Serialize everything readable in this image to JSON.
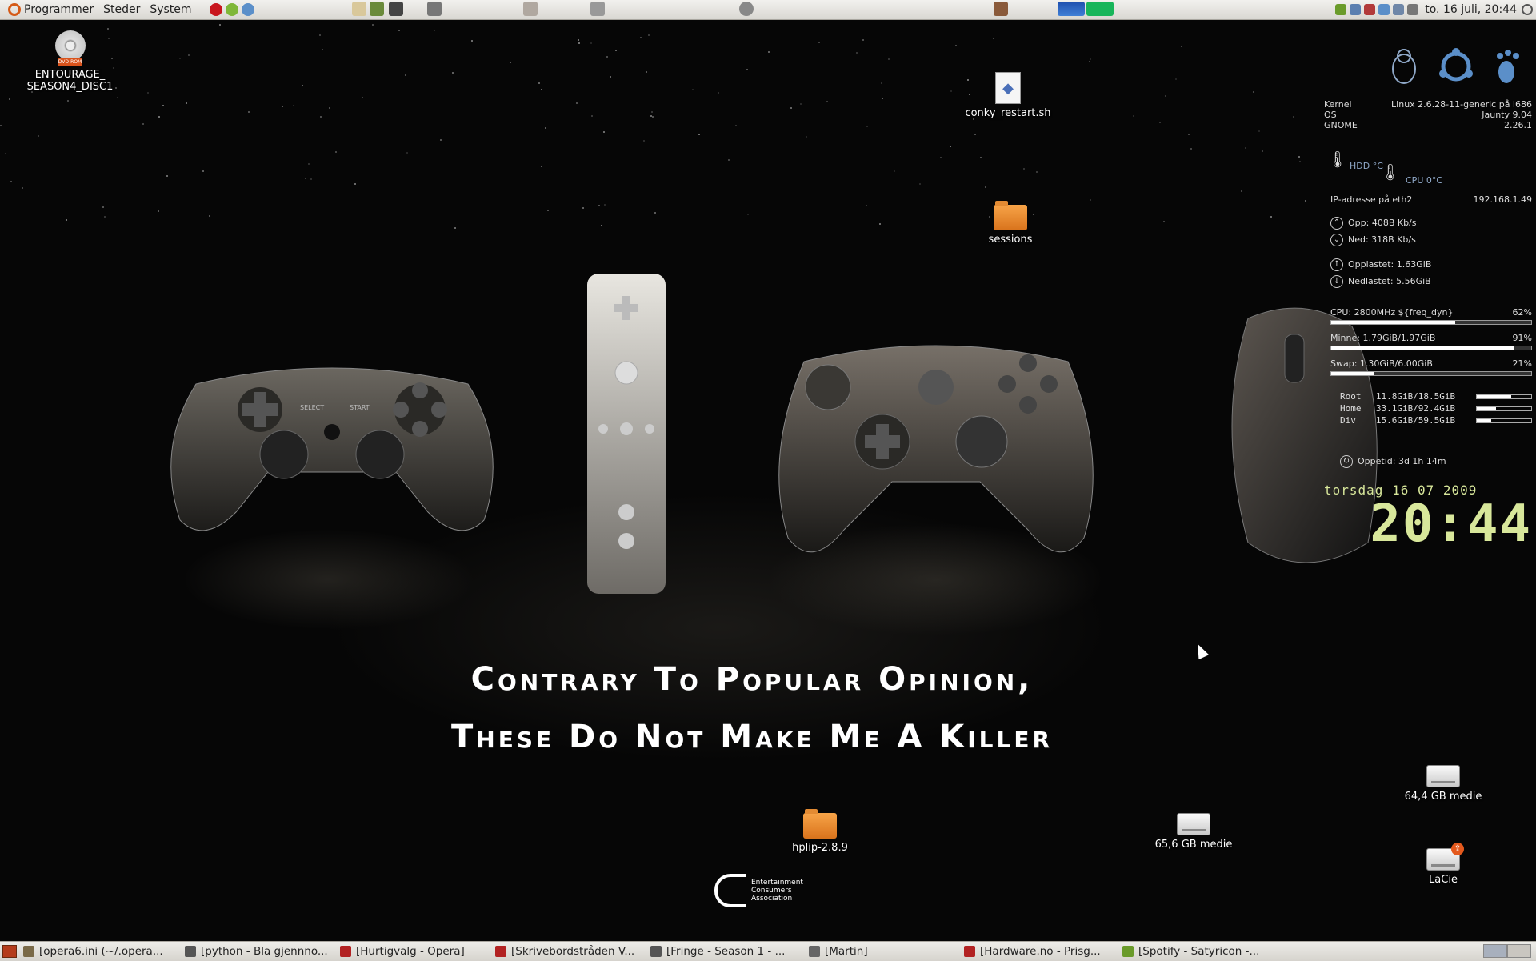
{
  "top_panel": {
    "menus": [
      "Programmer",
      "Steder",
      "System"
    ],
    "clock": "to. 16 juli, 20:44"
  },
  "desktop_icons": {
    "dvd": {
      "label": "ENTOURAGE_\nSEASON4_DISC1",
      "badge": "DVD-ROM"
    },
    "conky_restart": {
      "label": "conky_restart.sh"
    },
    "sessions": {
      "label": "sessions"
    },
    "hplip": {
      "label": "hplip-2.8.9"
    },
    "medie65": {
      "label": "65,6 GB medie"
    },
    "medie64": {
      "label": "64,4 GB medie"
    },
    "lacie": {
      "label": "LaCie"
    }
  },
  "wallpaper": {
    "caption_line1": "Contrary To Popular Opinion,",
    "caption_line2": "These Do Not Make Me A Killer",
    "eca_text": [
      "Entertainment",
      "Consumers",
      "Association"
    ],
    "ps3_labels": {
      "select": "SELECT",
      "start": "START"
    }
  },
  "conky": {
    "system": [
      {
        "label": "Kernel",
        "value": "Linux 2.6.28-11-generic på i686"
      },
      {
        "label": "OS",
        "value": "Jaunty 9.04"
      },
      {
        "label": "GNOME",
        "value": "2.26.1"
      }
    ],
    "hdd_temp": "HDD °C",
    "cpu_temp": "CPU 0°C",
    "ip_label": "IP-adresse på eth2",
    "ip_value": "192.168.1.49",
    "up": "Opp: 408B  Kb/s",
    "down": "Ned: 318B  Kb/s",
    "uploaded": "Opplastet: 1.63GiB",
    "downloaded": "Nedlastet: 5.56GiB",
    "cpu": {
      "label": "CPU:",
      "detail": "2800MHz ${freq_dyn}",
      "pct": "62%",
      "level": 0.62
    },
    "mem": {
      "label": "Minne:",
      "detail": "1.79GiB/1.97GiB",
      "pct": "91%",
      "level": 0.91
    },
    "swap": {
      "label": "Swap:",
      "detail": "1.30GiB/6.00GiB",
      "pct": "21%",
      "level": 0.21
    },
    "disks": [
      {
        "name": "Root",
        "value": "11.8GiB/18.5GiB",
        "level": 0.64
      },
      {
        "name": "Home",
        "value": "33.1GiB/92.4GiB",
        "level": 0.36
      },
      {
        "name": "Div",
        "value": "15.6GiB/59.5GiB",
        "level": 0.26
      }
    ],
    "uptime": "Oppetid: 3d 1h 14m",
    "date": "torsdag 16 07 2009",
    "time": "20:44"
  },
  "taskbar": [
    {
      "label": "[opera6.ini (~/.opera...",
      "icon_color": "#7a6a48"
    },
    {
      "label": "[python - Bla gjennno...",
      "icon_color": "#555555"
    },
    {
      "label": "[Hurtigvalg - Opera]",
      "icon_color": "#b22222"
    },
    {
      "label": "[Skrivebordstråden V...",
      "icon_color": "#b22222"
    },
    {
      "label": "[Fringe - Season 1 - ...",
      "icon_color": "#555555"
    },
    {
      "label": "[Martin]",
      "icon_color": "#666666"
    },
    {
      "label": "[Hardware.no - Prisg...",
      "icon_color": "#b22222"
    },
    {
      "label": "[Spotify - Satyricon -...",
      "icon_color": "#6a9b2a"
    }
  ],
  "colors": {
    "conky_clock": "#d8e79b",
    "panel": "#e6e4df",
    "folder": "#e88a2e"
  }
}
